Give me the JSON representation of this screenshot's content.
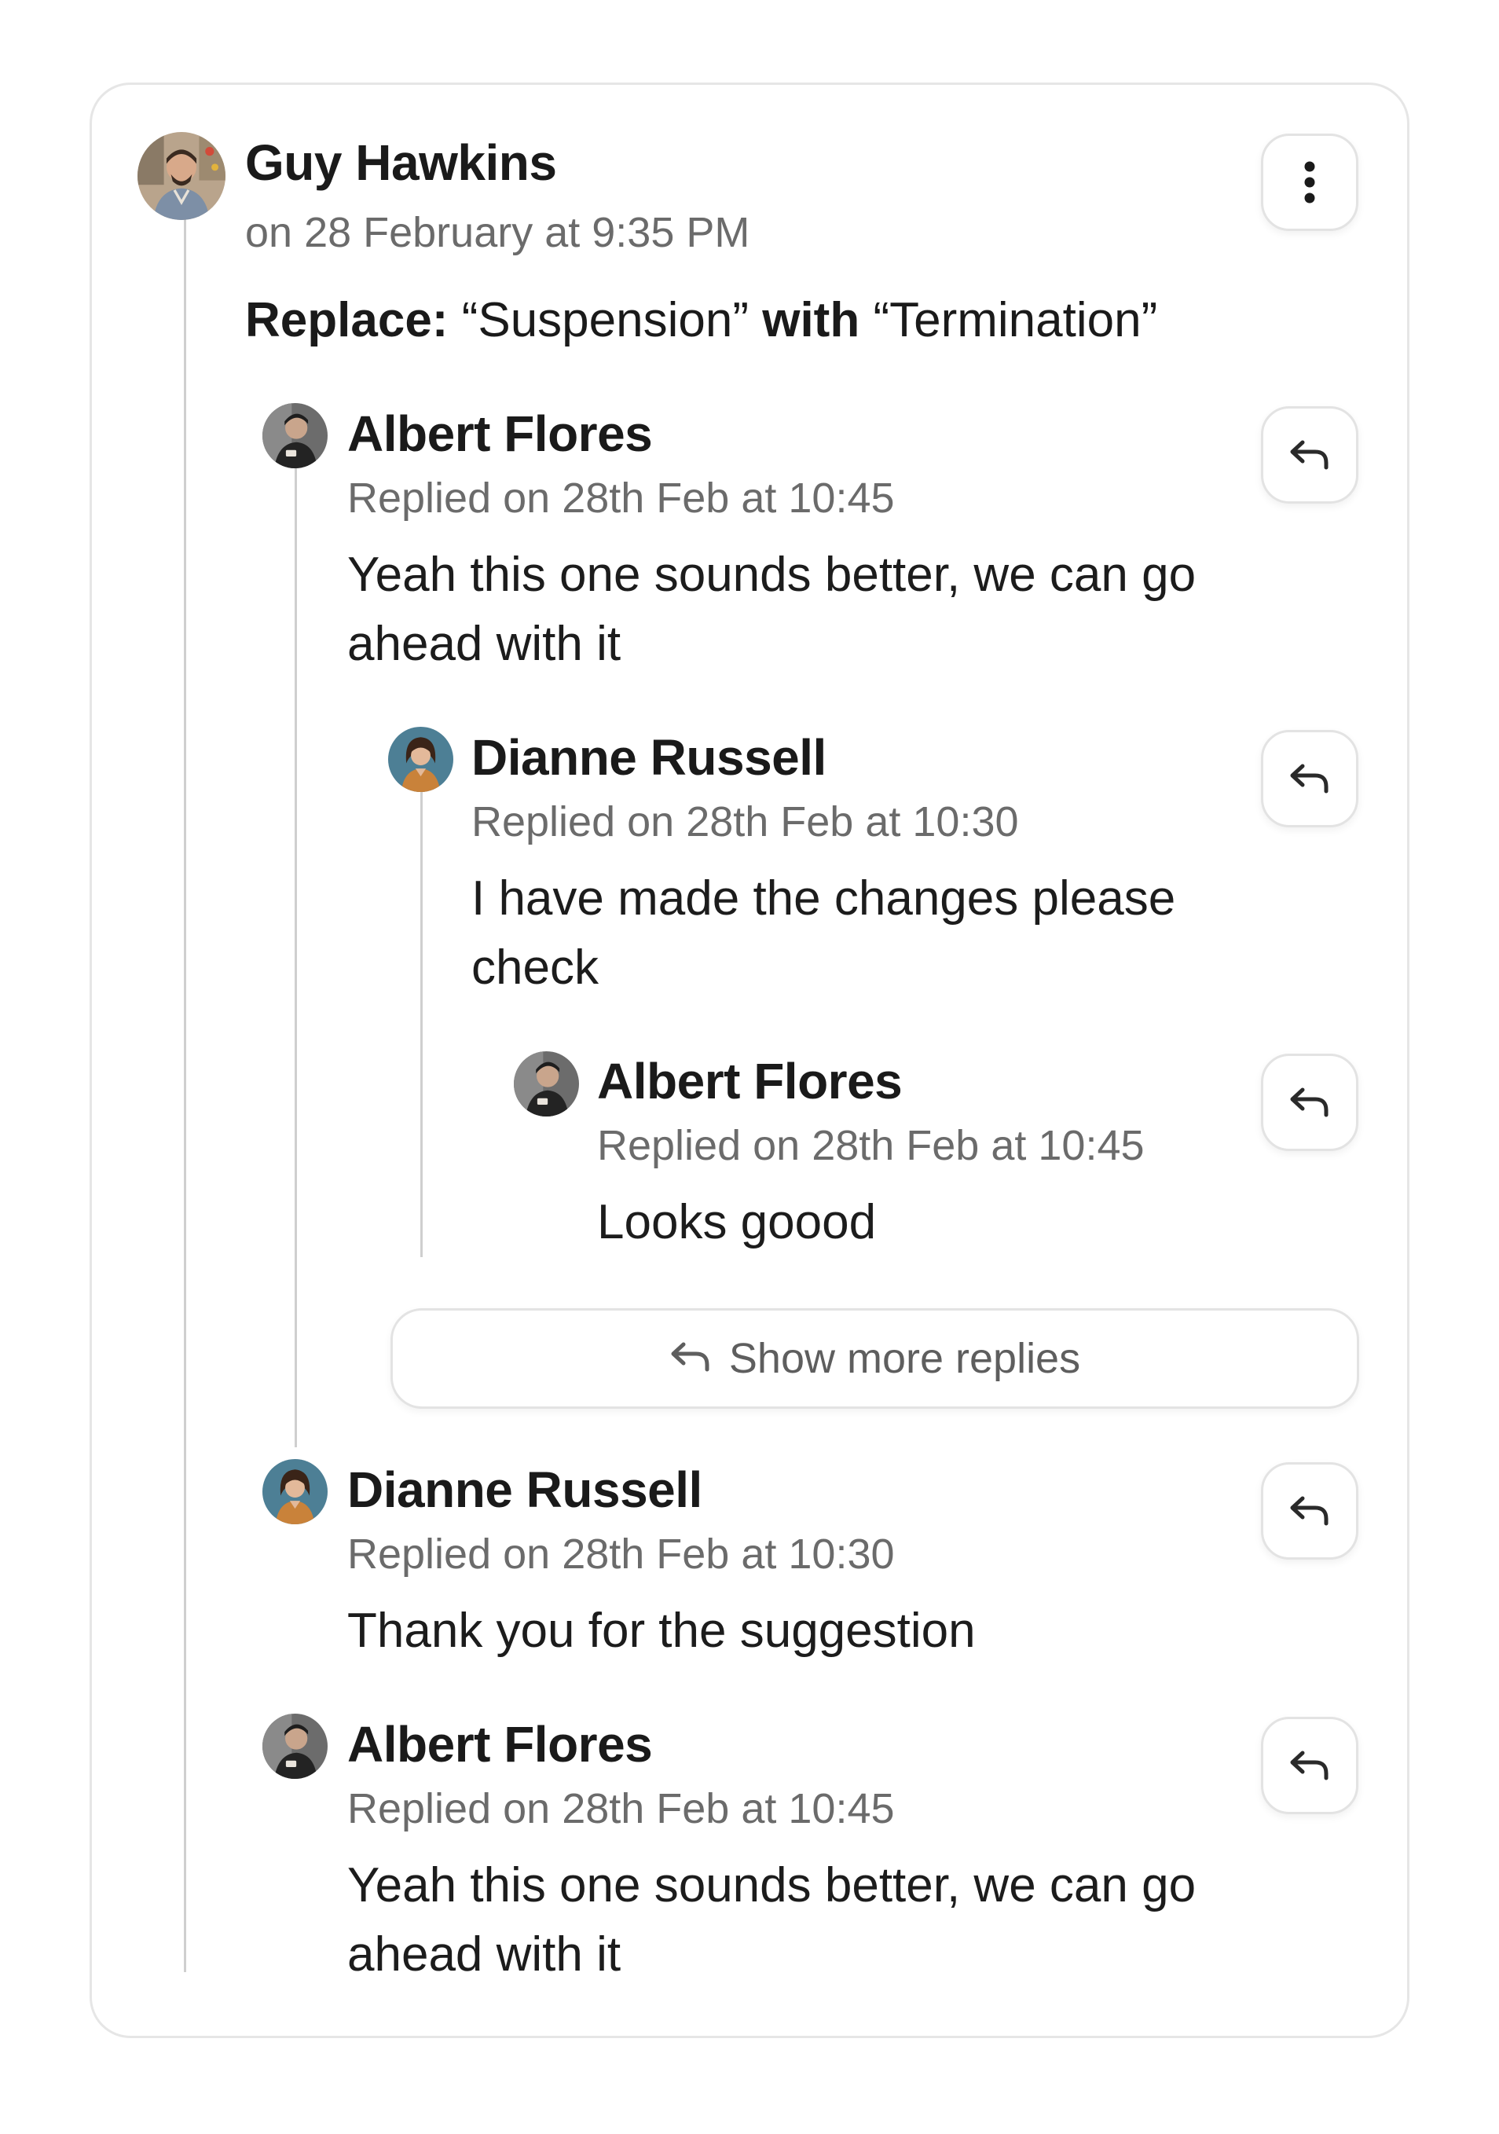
{
  "comment": {
    "author": "Guy Hawkins",
    "timestamp": "on 28 February at 9:35 PM",
    "suggestion": {
      "action_label": "Replace:",
      "from": "“Suspension”",
      "connector": "with",
      "to": "“Termination”"
    },
    "menu_icon": "more-vertical-icon"
  },
  "replies": [
    {
      "author": "Albert Flores",
      "meta": "Replied on 28th Feb at 10:45",
      "text": "Yeah this one sounds better, we can go ahead with it",
      "replies": [
        {
          "author": "Dianne Russell",
          "meta": "Replied on 28th Feb at 10:30",
          "text": "I have made the changes please check",
          "replies": [
            {
              "author": "Albert Flores",
              "meta": "Replied on 28th Feb at 10:45",
              "text": "Looks goood"
            }
          ]
        }
      ],
      "show_more_label": "Show more replies"
    },
    {
      "author": "Dianne Russell",
      "meta": "Replied on 28th Feb at 10:30",
      "text": "Thank you for the suggestion"
    },
    {
      "author": "Albert Flores",
      "meta": "Replied on 28th Feb at 10:45",
      "text": "Yeah this one sounds better, we can go ahead with it"
    }
  ],
  "icons": {
    "reply": "reply-arrow-icon",
    "more": "more-vertical-icon"
  },
  "colors": {
    "text": "#1c1c1c",
    "muted": "#6b6b6b",
    "border": "#e3e3e3",
    "thread_line": "#cfcfcf"
  }
}
